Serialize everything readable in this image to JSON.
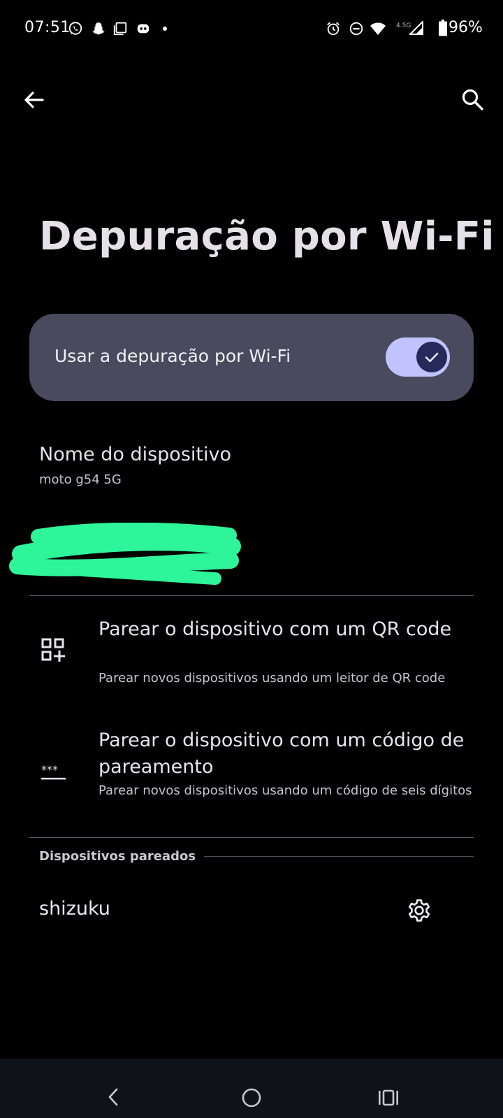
{
  "status_bar": {
    "time": "07:51",
    "network_label": "4.5G",
    "battery": "96%",
    "left_icons": [
      "whatsapp-icon",
      "snapchat-icon",
      "screenshot-icon",
      "discord-icon",
      "dot-icon"
    ],
    "right_icons": [
      "alarm-icon",
      "do-not-disturb-icon",
      "wifi-icon",
      "signal-icon",
      "battery-icon"
    ]
  },
  "app_bar": {
    "back_icon": "arrow-back-icon",
    "search_icon": "search-icon"
  },
  "page": {
    "title": "Depuração por Wi-Fi"
  },
  "main_switch": {
    "label": "Usar a depuração por Wi-Fi",
    "checked": true,
    "track_color": "#c1c3ff",
    "thumb_color": "#262a5a"
  },
  "device_name": {
    "title": "Nome do dispositivo",
    "summary": "moto g54 5G"
  },
  "redacted": {
    "color": "#2ef59a"
  },
  "pair_qr": {
    "title": "Parear o dispositivo com um QR code",
    "summary": "Parear novos dispositivos usando um leitor de QR code",
    "icon": "qr-code-add-icon"
  },
  "pair_code": {
    "title": "Parear o dispositivo com um código de pareamento",
    "summary": "Parear novos dispositivos usando um código de seis dígitos",
    "icon": "password-dots-icon"
  },
  "paired_devices": {
    "category": "Dispositivos pareados",
    "items": [
      {
        "name": "shizuku",
        "icon": "gear-icon"
      }
    ]
  },
  "nav_bar": {
    "icons": [
      "nav-back-icon",
      "nav-home-icon",
      "nav-recents-icon"
    ]
  }
}
